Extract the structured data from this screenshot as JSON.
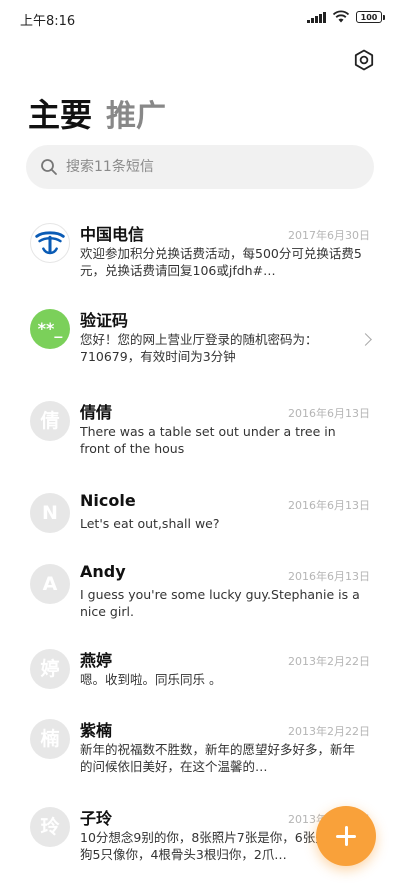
{
  "status_bar": {
    "time": "上午8:16",
    "battery": "100"
  },
  "tabs": {
    "primary": "主要",
    "secondary": "推广"
  },
  "search": {
    "placeholder": "搜索11条短信"
  },
  "messages": [
    {
      "name": "中国电信",
      "date": "2017年6月30日",
      "snippet": "欢迎参加积分兑换话费活动，每500分可兑换话费5元，兑换话费请回复106或jfdh#…",
      "avatar_text": "",
      "avatar_icon": "china-telecom-logo"
    },
    {
      "name": "验证码",
      "date": "",
      "snippet": "您好！您的网上营业厅登录的随机密码为：710679，有效时间为3分钟",
      "avatar_text": "**_",
      "avatar_color": "#7bd05a"
    },
    {
      "name": "倩倩",
      "date": "2016年6月13日",
      "snippet": "There was a table set out under a tree in front of the hous",
      "avatar_text": "倩"
    },
    {
      "name": "Nicole",
      "date": "2016年6月13日",
      "snippet": "Let's eat out,shall we?",
      "avatar_text": "N"
    },
    {
      "name": "Andy",
      "date": "2016年6月13日",
      "snippet": "I guess you're some lucky guy.Stephanie is a nice girl.",
      "avatar_text": "A"
    },
    {
      "name": "燕婷",
      "date": "2013年2月22日",
      "snippet": "嗯。收到啦。同乐同乐 。",
      "avatar_text": "婷"
    },
    {
      "name": "紫楠",
      "date": "2013年2月22日",
      "snippet": "新年的祝福数不胜数，新年的愿望好多好多，新年的问候依旧美好，在这个温馨的…",
      "avatar_text": "楠"
    },
    {
      "name": "子玲",
      "date": "2013年2月22日",
      "snippet": "10分想念9别的你，8张照片7张是你，6张是你小狗5只像你，4根骨头3根归你，2爪…",
      "avatar_text": "玲"
    }
  ],
  "colors": {
    "accent": "#f9a13a",
    "avatar_default": "#e7e7e7",
    "telecom_blue": "#0a5bb5"
  },
  "icons": {
    "settings": "settings-hexagon-icon",
    "search": "search-icon",
    "fab": "plus-icon"
  }
}
